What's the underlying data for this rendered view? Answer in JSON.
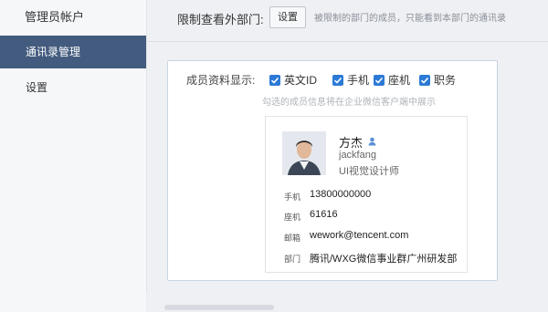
{
  "sidebar": {
    "title": "管理员帐户",
    "items": [
      {
        "label": "通讯录管理",
        "active": true
      },
      {
        "label": "设置",
        "active": false
      }
    ]
  },
  "top": {
    "label": "限制查看外部门:",
    "button": "设置",
    "hint": "被限制的部门的成员，只能看到本部门的通讯录"
  },
  "profile_display": {
    "label": "成员资料显示:",
    "hint": "勾选的成员信息将在企业微信客户端中展示",
    "options": [
      {
        "label": "英文ID",
        "checked": true
      },
      {
        "label": "手机",
        "checked": true
      },
      {
        "label": "座机",
        "checked": true
      },
      {
        "label": "职务",
        "checked": true
      }
    ]
  },
  "card": {
    "name": "方杰",
    "alias": "jackfang",
    "title": "UI视觉设计师",
    "rows": [
      {
        "label": "手机",
        "value": "13800000000"
      },
      {
        "label": "座机",
        "value": "61616"
      },
      {
        "label": "邮箱",
        "value": "wework@tencent.com"
      },
      {
        "label": "部门",
        "value": "腾讯/WXG微信事业群广州研发部"
      }
    ]
  },
  "colors": {
    "accent": "#2c7ad6",
    "sidebar_active": "#435b7e"
  }
}
